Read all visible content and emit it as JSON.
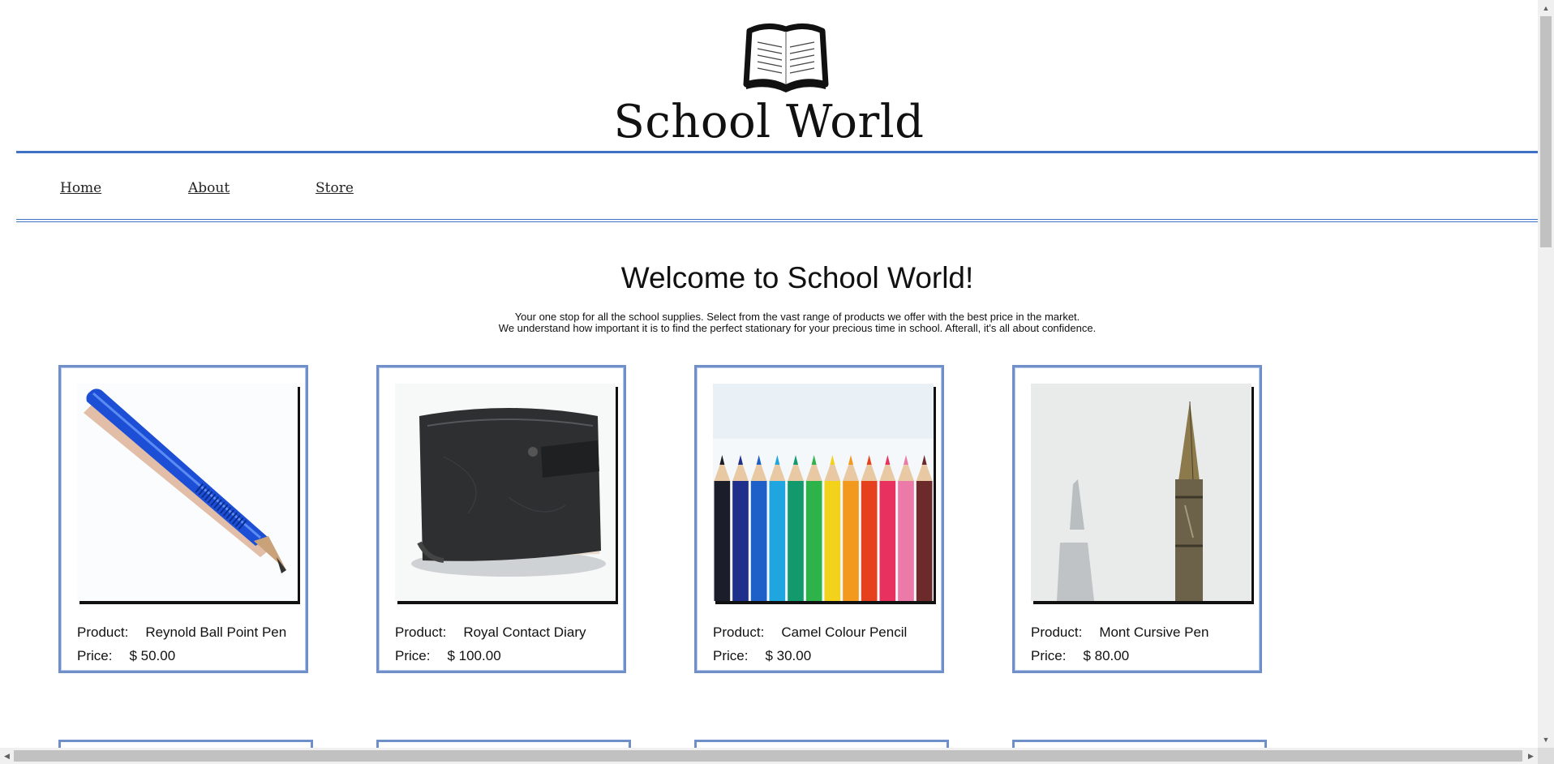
{
  "header": {
    "site_title": "School World",
    "logo_icon": "open-book-icon"
  },
  "nav": {
    "items": [
      {
        "label": "Home"
      },
      {
        "label": "About"
      },
      {
        "label": "Store"
      }
    ]
  },
  "main": {
    "title": "Welcome to School World!",
    "intro_line1": "Your one stop for all the school supplies. Select from the vast range of products we offer with the best price in the market.",
    "intro_line2": "We understand how important it is to find the perfect stationary for your precious time in school. Afterall, it's all about confidence."
  },
  "labels": {
    "product": "Product:",
    "price": "Price:"
  },
  "products": [
    {
      "name": "Reynold Ball Point Pen",
      "price": "$ 50.00",
      "image_icon": "ballpoint-pen-image"
    },
    {
      "name": "Royal Contact Diary",
      "price": "$ 100.00",
      "image_icon": "diary-image"
    },
    {
      "name": "Camel Colour Pencil",
      "price": "$ 30.00",
      "image_icon": "colour-pencils-image"
    },
    {
      "name": "Mont Cursive Pen",
      "price": "$ 80.00",
      "image_icon": "fountain-pen-image"
    }
  ],
  "colors": {
    "accent": "#3f72c4",
    "card_border": "#6f8fc9"
  }
}
